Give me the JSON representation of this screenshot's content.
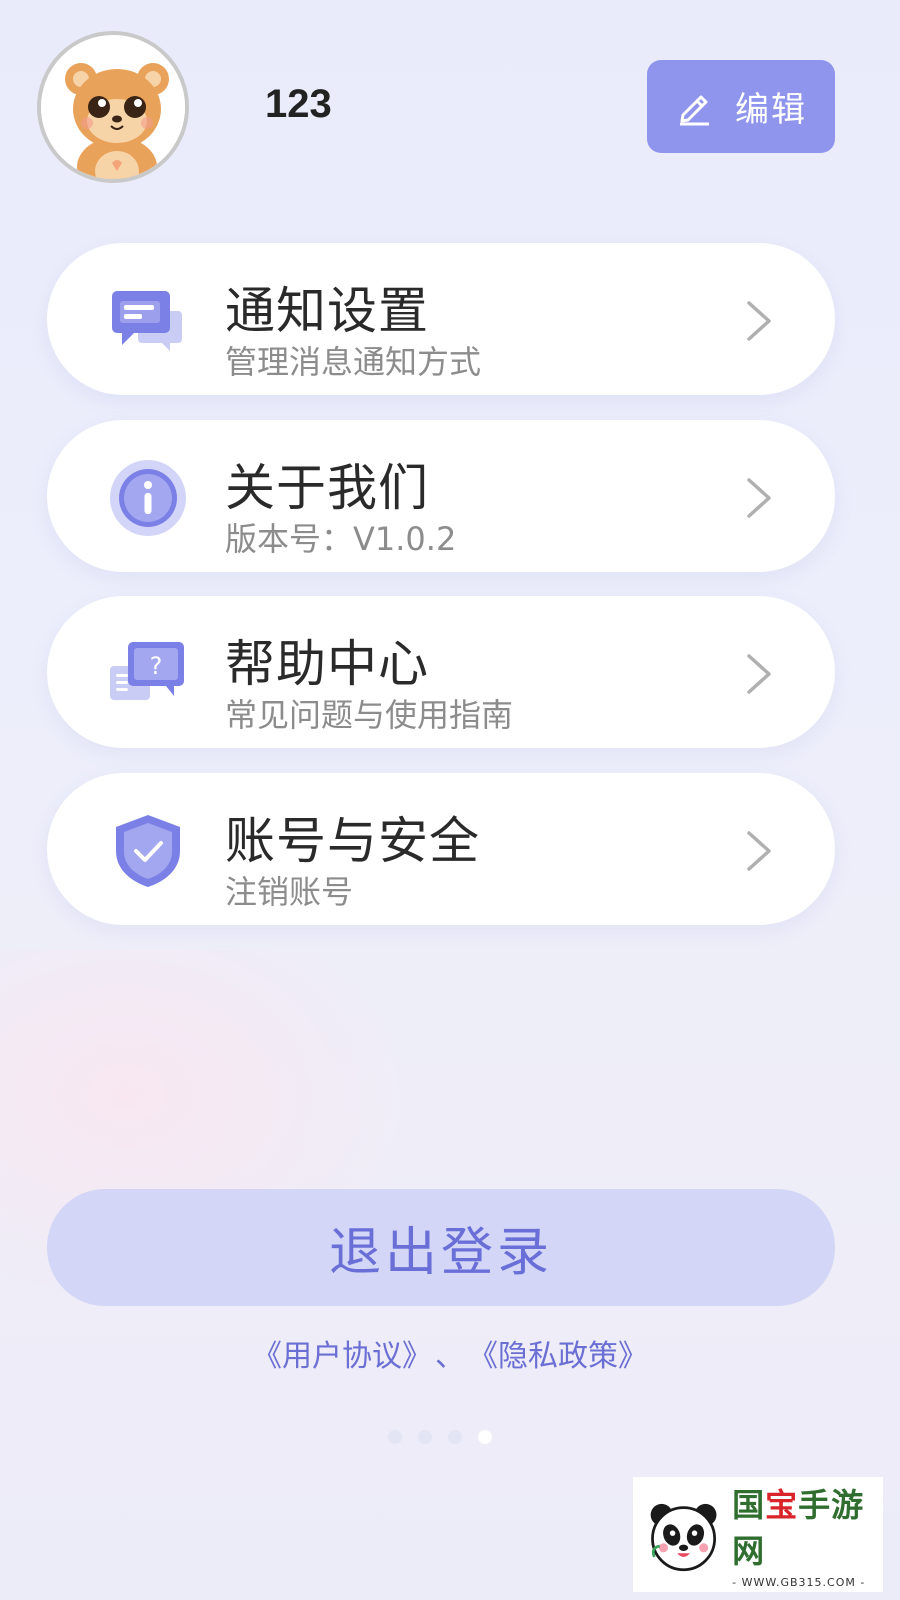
{
  "profile": {
    "username": "123",
    "edit_label": "编辑"
  },
  "menu": [
    {
      "title": "通知设置",
      "subtitle": "管理消息通知方式",
      "icon": "message-icon"
    },
    {
      "title": "关于我们",
      "subtitle": "版本号：V1.0.2",
      "icon": "info-icon"
    },
    {
      "title": "帮助中心",
      "subtitle": "常见问题与使用指南",
      "icon": "help-chat-icon"
    },
    {
      "title": "账号与安全",
      "subtitle": "注销账号",
      "icon": "shield-check-icon"
    }
  ],
  "logout_label": "退出登录",
  "agreements": {
    "user_agreement": "《用户协议》",
    "separator": "、",
    "privacy_policy": "《隐私政策》"
  },
  "pager": {
    "count": 4,
    "active_index": 3
  },
  "watermark": {
    "title_part1": "国",
    "title_part2": "宝",
    "title_part3": "手游网",
    "url": "- WWW.GB315.COM -"
  },
  "colors": {
    "accent": "#8f95ed",
    "logout_bg": "#d3d6f7",
    "logout_text": "#6a6fd8",
    "link": "#6b6fd4"
  }
}
